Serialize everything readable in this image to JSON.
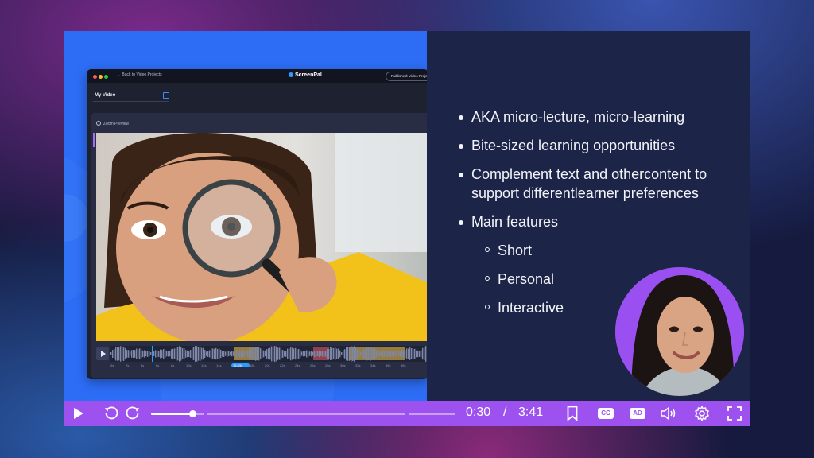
{
  "app": {
    "back_link": "Back to Video Projects",
    "logo": "ScreenPal",
    "published": "Published: Video Project",
    "project_name": "My Video",
    "zoom_preview": "Zoom Preview",
    "timeline_ticks": [
      "0s",
      "2s",
      "4s",
      "6s",
      "8s",
      "10s",
      "12s",
      "14s",
      "16.83s",
      "18s",
      "20s",
      "22s",
      "24s",
      "26s",
      "28s",
      "30s",
      "32s",
      "34s",
      "36s",
      "38s"
    ]
  },
  "slide": {
    "bullets": [
      {
        "text": "AKA micro-lecture, micro-learning"
      },
      {
        "text": "Bite-sized learning opportunities"
      },
      {
        "text": "Complement text and othercontent to support differentlearner preferences"
      },
      {
        "text": "Main features"
      }
    ],
    "sub_bullets": [
      "Short",
      "Personal",
      "Interactive"
    ]
  },
  "player": {
    "current_time": "0:30",
    "separator": "/",
    "duration": "3:41",
    "progress_fraction": 0.136,
    "cc_label": "CC",
    "ad_label": "AD",
    "accent_color": "#9d52ef",
    "icons": [
      "play-icon",
      "rewind-icon",
      "forward-icon",
      "bookmark-icon",
      "cc-icon",
      "ad-icon",
      "volume-icon",
      "gear-icon",
      "fullscreen-icon"
    ]
  }
}
